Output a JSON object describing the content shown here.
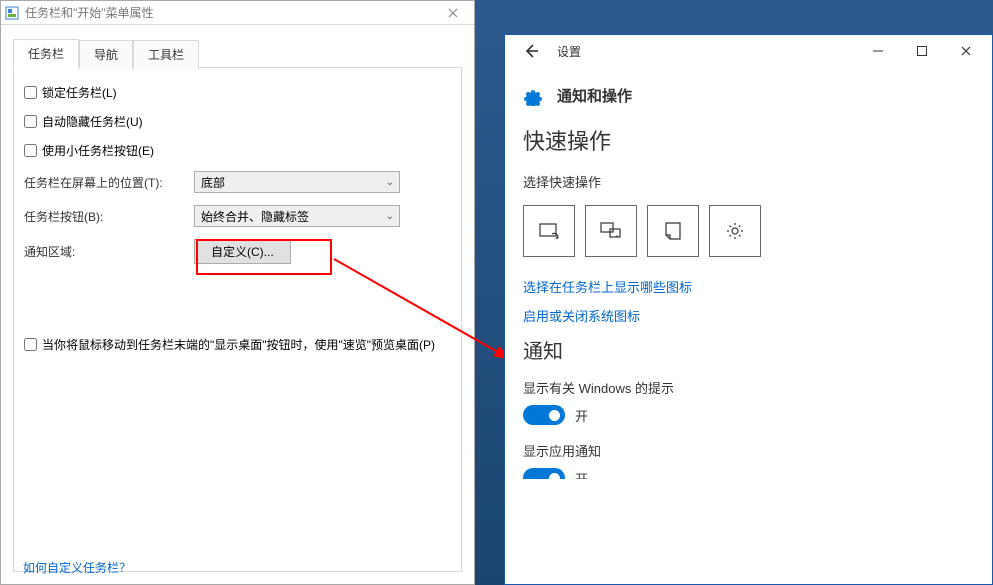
{
  "props": {
    "title": "任务栏和\"开始\"菜单属性",
    "tabs": [
      "任务栏",
      "导航",
      "工具栏"
    ],
    "lockTaskbar": "锁定任务栏(L)",
    "autoHide": "自动隐藏任务栏(U)",
    "smallButtons": "使用小任务栏按钮(E)",
    "positionLabel": "任务栏在屏幕上的位置(T):",
    "positionValue": "底部",
    "buttonsLabel": "任务栏按钮(B):",
    "buttonsValue": "始终合并、隐藏标签",
    "notifyArea": "通知区域:",
    "customizeBtn": "自定义(C)...",
    "peekDesktop": "当你将鼠标移动到任务栏末端的\"显示桌面\"按钮时，使用\"速览\"预览桌面(P)",
    "howToLink": "如何自定义任务栏？"
  },
  "settings": {
    "winTitle": "设置",
    "headerText": "通知和操作",
    "quickHeading": "快速操作",
    "quickSub": "选择快速操作",
    "link1": "选择在任务栏上显示哪些图标",
    "link2": "启用或关闭系统图标",
    "notifyHeading": "通知",
    "toggle1Label": "显示有关 Windows 的提示",
    "toggle1Text": "开",
    "toggle2Label": "显示应用通知",
    "toggle2Text": "开"
  }
}
